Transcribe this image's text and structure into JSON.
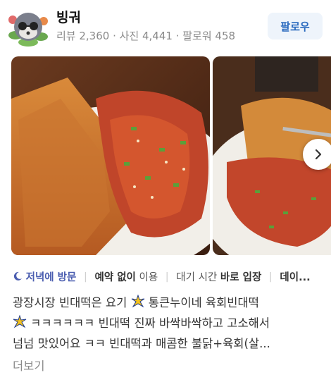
{
  "profile": {
    "name": "빙궈",
    "stats": "리뷰 2,360 · 사진 4,441 · 팔로워 458",
    "follow_label": "팔로우"
  },
  "tags": {
    "tag1": "저녁에 방문",
    "tag2_strong": "예약 없이",
    "tag2_rest": " 이용",
    "tag3_rest": "대기 시간 ",
    "tag3_strong": "바로 입장",
    "tag4": "데이..."
  },
  "review": {
    "line1": "광장시장 빈대떡은 요기",
    "line1b": " 통큰누이네 육회빈대떡",
    "line2": " ㅋㅋㅋㅋㅋㅋ 빈대떡 진짜 바싹바싹하고 고소해서",
    "line3": "넘넘 맛있어요 ㅋㅋ 빈대떡과 매콤한 불닭+육회(살...",
    "more_label": "더보기"
  },
  "icons": {
    "moon": "moon-icon",
    "next": "chevron-right-icon",
    "sparkle": "sparkle-emoji-icon",
    "avatar": "raccoon-avatar"
  }
}
